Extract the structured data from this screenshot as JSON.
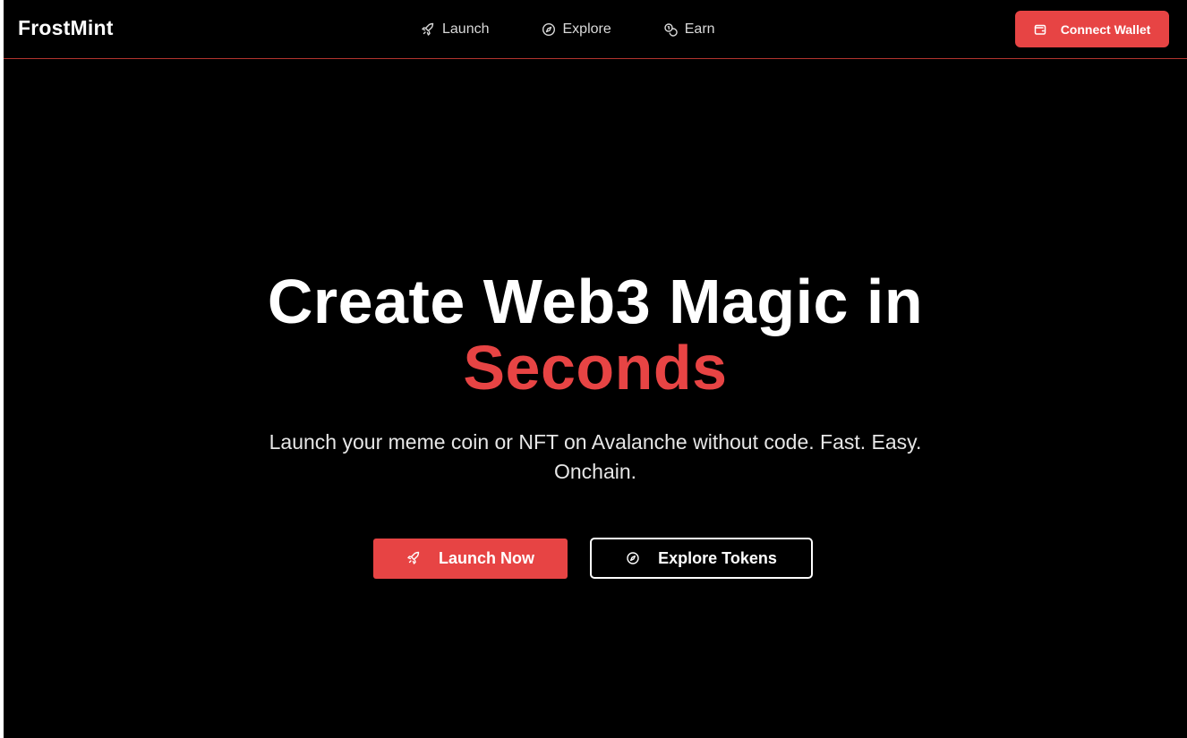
{
  "header": {
    "brand": "FrostMint",
    "nav": [
      {
        "label": "Launch",
        "icon": "rocket-icon"
      },
      {
        "label": "Explore",
        "icon": "compass-icon"
      },
      {
        "label": "Earn",
        "icon": "coins-icon"
      }
    ],
    "connect_label": "Connect Wallet",
    "connect_icon": "wallet-icon"
  },
  "hero": {
    "title_line1": "Create Web3 Magic in",
    "title_accent": "Seconds",
    "subtitle": "Launch your meme coin or NFT on Avalanche without code. Fast. Easy. Onchain.",
    "primary_label": "Launch Now",
    "primary_icon": "rocket-icon",
    "secondary_label": "Explore Tokens",
    "secondary_icon": "compass-icon"
  },
  "colors": {
    "background": "#000000",
    "accent": "#e74444",
    "text": "#ffffff",
    "muted_text": "#d9d9d9",
    "header_border": "#b3342f"
  }
}
